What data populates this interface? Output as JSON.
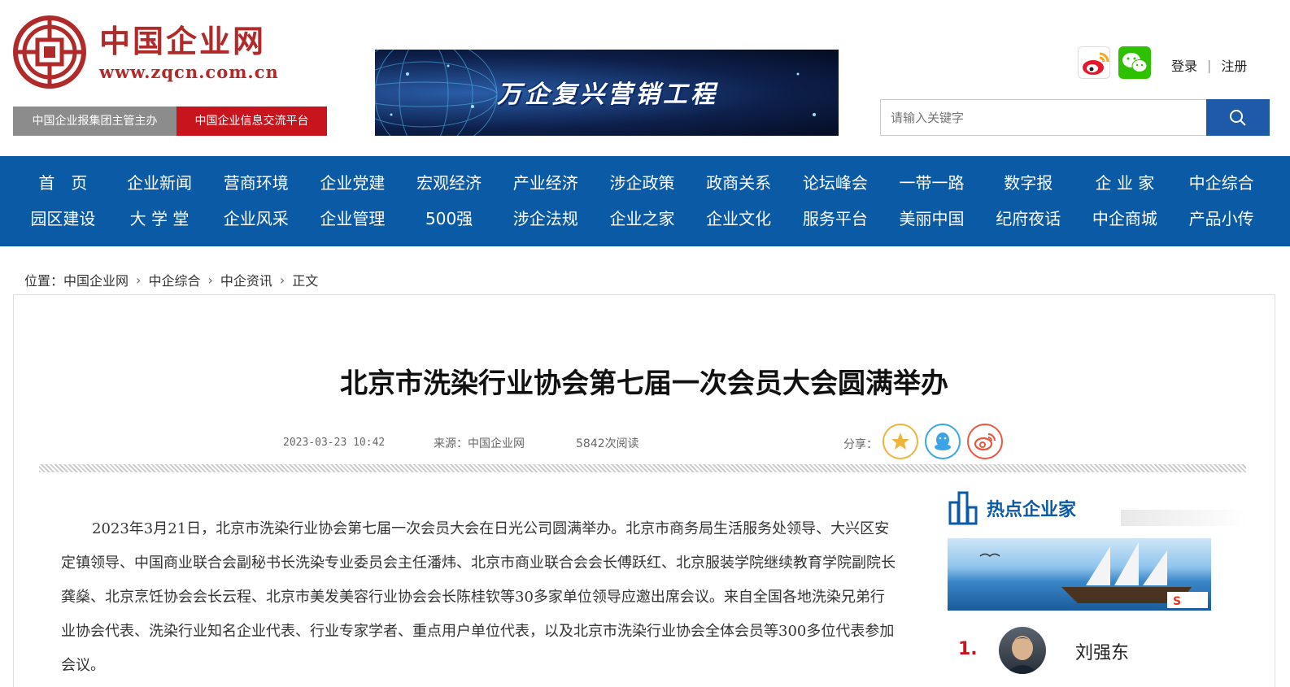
{
  "logo": {
    "title": "中国企业网",
    "url": "www.zqcn.com.cn"
  },
  "tags": {
    "left": "中国企业报集团主管主办",
    "right": "中国企业信息交流平台"
  },
  "banner": {
    "text": "万企复兴营销工程"
  },
  "auth": {
    "login": "登录",
    "register": "注册"
  },
  "search": {
    "placeholder": "请输入关键字"
  },
  "nav": {
    "row1": [
      "首　页",
      "企业新闻",
      "营商环境",
      "企业党建",
      "宏观经济",
      "产业经济",
      "涉企政策",
      "政商关系",
      "论坛峰会",
      "一带一路",
      "数字报",
      "企 业 家",
      "中企综合"
    ],
    "row2": [
      "园区建设",
      "大 学 堂",
      "企业风采",
      "企业管理",
      "500强",
      "涉企法规",
      "企业之家",
      "企业文化",
      "服务平台",
      "美丽中国",
      "纪府夜话",
      "中企商城",
      "产品小传"
    ]
  },
  "breadcrumb": {
    "prefix": "位置：",
    "items": [
      "中国企业网",
      "中企综合",
      "中企资讯",
      "正文"
    ]
  },
  "article": {
    "title": "北京市洗染行业协会第七届一次会员大会圆满举办",
    "date": "2023-03-23 10:42",
    "source": "来源：中国企业网",
    "reads": "5842次阅读",
    "share_label": "分享：",
    "paragraph": "2023年3月21日，北京市洗染行业协会第七届一次会员大会在日光公司圆满举办。北京市商务局生活服务处领导、大兴区安定镇领导、中国商业联合会副秘书长洗染专业委员会主任潘炜、北京市商业联合会会长傅跃红、北京服装学院继续教育学院副院长龚燊、北京烹饪协会会长云程、北京市美发美容行业协会会长陈桂钦等30多家单位领导应邀出席会议。来自全国各地洗染兄弟行业协会代表、洗染行业知名企业代表、行业专家学者、重点用户单位代表，以及北京市洗染行业协会全体会员等300多位代表参加会议。"
  },
  "sidebar": {
    "title": "热点企业家",
    "top": {
      "rank": "1.",
      "name": "刘强东"
    }
  },
  "colors": {
    "brand_red": "#b02a2a",
    "nav_blue": "#0a5aa5",
    "tag_red": "#c8141c"
  }
}
